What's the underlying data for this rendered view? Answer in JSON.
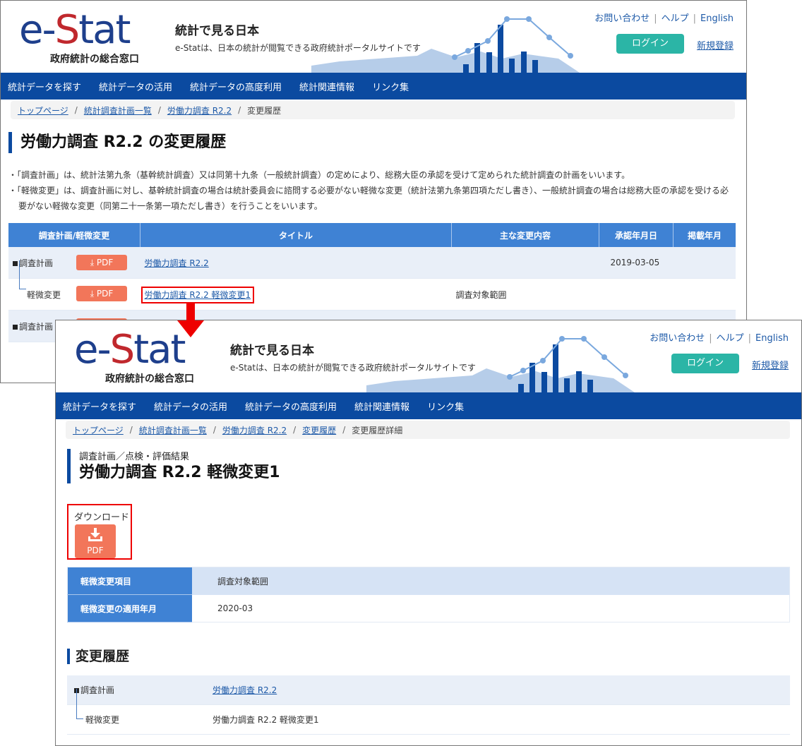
{
  "site": {
    "logo_e": "e-",
    "logo_s": "S",
    "logo_tat": "tat",
    "logo_subtitle": "政府統計の総合窓口",
    "title": "統計で見る日本",
    "description": "e-Statは、日本の統計が閲覧できる政府統計ポータルサイトです",
    "top_links": [
      "お問い合わせ",
      "ヘルプ",
      "English"
    ],
    "login_label": "ログイン",
    "register_label": "新規登録",
    "nav": [
      "統計データを探す",
      "統計データの活用",
      "統計データの高度利用",
      "統計関連情報",
      "リンク集"
    ],
    "colors": {
      "brand_blue": "#0b4aa0",
      "login_green": "#2bb5a6",
      "pdf_orange": "#f2765a",
      "table_header": "#3f82d4",
      "highlight_red": "#ee0000"
    }
  },
  "page1": {
    "breadcrumb": [
      "トップページ",
      "統計調査計画一覧",
      "労働力調査 R2.2",
      "変更履歴"
    ],
    "heading": "労働力調査 R2.2 の変更履歴",
    "notes": [
      "・「調査計画」は、統計法第九条（基幹統計調査）又は同第十九条（一般統計調査）の定めにより、総務大臣の承認を受けて定められた統計調査の計画をいいます。",
      "・「軽微変更」は、調査計画に対し、基幹統計調査の場合は統計委員会に諮問する必要がない軽微な変更（統計法第九条第四項ただし書き）、一般統計調査の場合は総務大臣の承認を受ける必要がない軽微な変更（同第二十一条第一項ただし書き）を行うことをいいます。"
    ],
    "table": {
      "headers": [
        "調査計画/軽微変更",
        "タイトル",
        "主な変更内容",
        "承認年月日",
        "掲載年月"
      ],
      "pdf_label": "PDF",
      "rows": [
        {
          "type": "調査計画",
          "title": "労働力調査 R2.2",
          "change": "",
          "approved": "2019-03-05",
          "posted": ""
        },
        {
          "type": "軽微変更",
          "title": "労働力調査 R2.2 軽微変更1",
          "change": "調査対象範囲",
          "approved": "",
          "posted": ""
        },
        {
          "type": "調査計画",
          "title": "",
          "change": "",
          "approved": "",
          "posted": ""
        }
      ]
    }
  },
  "page2": {
    "breadcrumb": [
      "トップページ",
      "統計調査計画一覧",
      "労働力調査 R2.2",
      "変更履歴",
      "変更履歴詳細"
    ],
    "subtitle": "調査計画／点検・評価結果",
    "heading": "労働力調査 R2.2 軽微変更1",
    "download_label": "ダウンロード",
    "pdf_label": "PDF",
    "details": [
      {
        "label": "軽微変更項目",
        "value": "調査対象範囲"
      },
      {
        "label": "軽微変更の適用年月",
        "value": "2020-03"
      }
    ],
    "history_heading": "変更履歴",
    "history": [
      {
        "type": "調査計画",
        "title": "労働力調査 R2.2",
        "is_link": true
      },
      {
        "type": "軽微変更",
        "title": "労働力調査 R2.2 軽微変更1",
        "is_link": false
      }
    ]
  }
}
